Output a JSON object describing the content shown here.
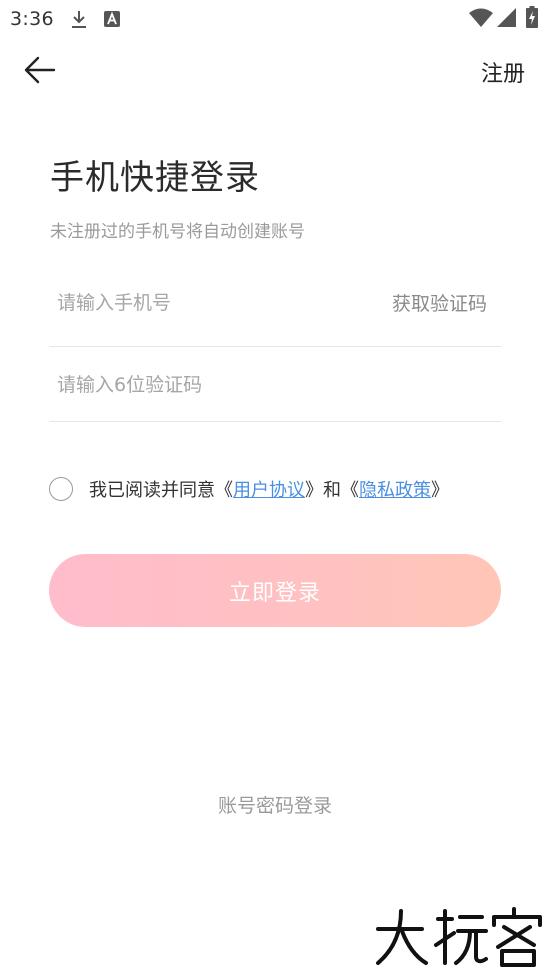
{
  "status_bar": {
    "time": "3:36",
    "icons": [
      "download-icon",
      "font-notification-icon",
      "wifi-icon",
      "cellular-signal-icon",
      "battery-charging-icon"
    ]
  },
  "nav": {
    "back_icon": "arrow-left-icon",
    "register_label": "注册"
  },
  "header": {
    "title": "手机快捷登录",
    "subtitle": "未注册过的手机号将自动创建账号"
  },
  "form": {
    "phone_placeholder": "请输入手机号",
    "phone_value": "",
    "get_code_label": "获取验证码",
    "code_placeholder": "请输入6位验证码",
    "code_value": ""
  },
  "agreement": {
    "checked": false,
    "prefix": "我已阅读并同意《",
    "user_agreement": "用户协议",
    "middle": "》和《",
    "privacy_policy": "隐私政策",
    "suffix": "》"
  },
  "login_button": {
    "label": "立即登录"
  },
  "footer": {
    "password_login_label": "账号密码登录"
  },
  "watermark": {
    "text": "大玩客"
  },
  "colors": {
    "link": "#4a8fe0",
    "button_gradient_start": "#ffbccb",
    "button_gradient_end": "#ffc6b6",
    "placeholder": "#a6a6a6"
  }
}
